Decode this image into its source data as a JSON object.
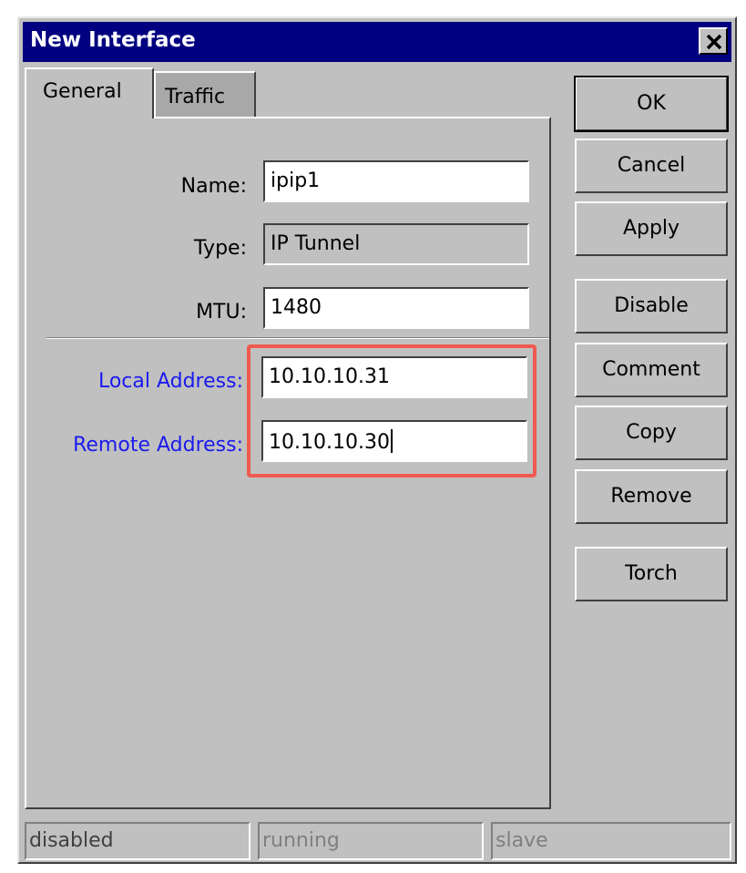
{
  "window": {
    "title": "New Interface"
  },
  "tabs": [
    {
      "label": "General",
      "active": true
    },
    {
      "label": "Traffic",
      "active": false
    }
  ],
  "form": {
    "name": {
      "label": "Name:",
      "value": "ipip1"
    },
    "type": {
      "label": "Type:",
      "value": "IP Tunnel"
    },
    "mtu": {
      "label": "MTU:",
      "value": "1480"
    },
    "local_address": {
      "label": "Local Address:",
      "value": "10.10.10.31"
    },
    "remote_address": {
      "label": "Remote Address:",
      "value": "10.10.10.30"
    }
  },
  "buttons": {
    "ok": "OK",
    "cancel": "Cancel",
    "apply": "Apply",
    "disable": "Disable",
    "comment": "Comment",
    "copy": "Copy",
    "remove": "Remove",
    "torch": "Torch"
  },
  "status": {
    "disabled": "disabled",
    "running": "running",
    "slave": "slave"
  },
  "icons": {
    "close": "close-icon"
  },
  "colors": {
    "title_bg": "#000080",
    "highlight": "#f05a4e",
    "link_label": "#1a1aee"
  }
}
